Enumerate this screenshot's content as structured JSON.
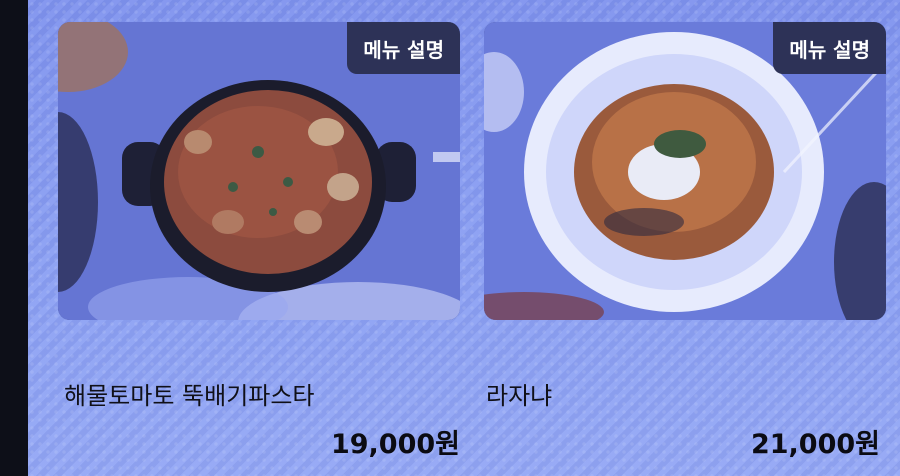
{
  "menu": {
    "items": [
      {
        "name": "해물토마토 뚝배기파스타",
        "price": "19,000원",
        "description_button": "메뉴 설명",
        "image_icon": "seafood-tomato-pasta-pot-photo"
      },
      {
        "name": "라자냐",
        "price": "21,000원",
        "description_button": "메뉴 설명",
        "image_icon": "lasagna-plate-photo"
      }
    ]
  },
  "colors": {
    "screen_tint": "#8ba0f3",
    "button_bg": "#2d3257",
    "button_text": "#ffffff",
    "text": "#101018"
  }
}
